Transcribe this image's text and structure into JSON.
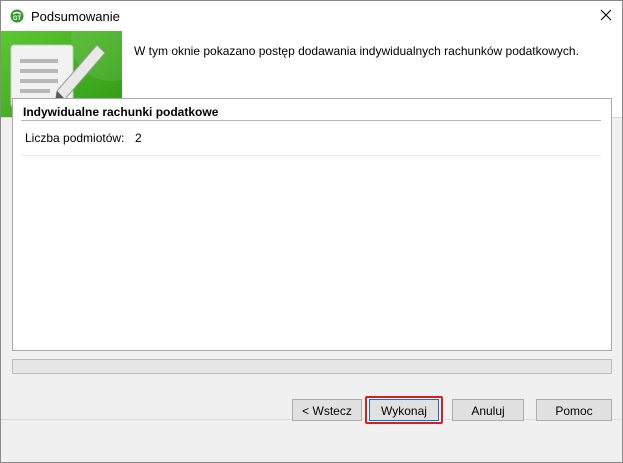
{
  "window": {
    "title": "Podsumowanie"
  },
  "header": {
    "description": "W tym oknie pokazano postęp dodawania indywidualnych rachunków podatkowych."
  },
  "section": {
    "title": "Indywidualne rachunki podatkowe",
    "rows": [
      {
        "label": "Liczba podmiotów:",
        "value": "2"
      }
    ]
  },
  "progress": {
    "fraction": 0
  },
  "buttons": {
    "back": "< Wstecz",
    "execute": "Wykonaj",
    "cancel": "Anuluj",
    "help": "Pomoc"
  },
  "colors": {
    "banner_green": "#3fae1c",
    "highlight_red": "#d61f1f"
  },
  "icons": {
    "app": "app-logo-icon",
    "close": "close-icon",
    "banner": "document-pencil-icon"
  }
}
